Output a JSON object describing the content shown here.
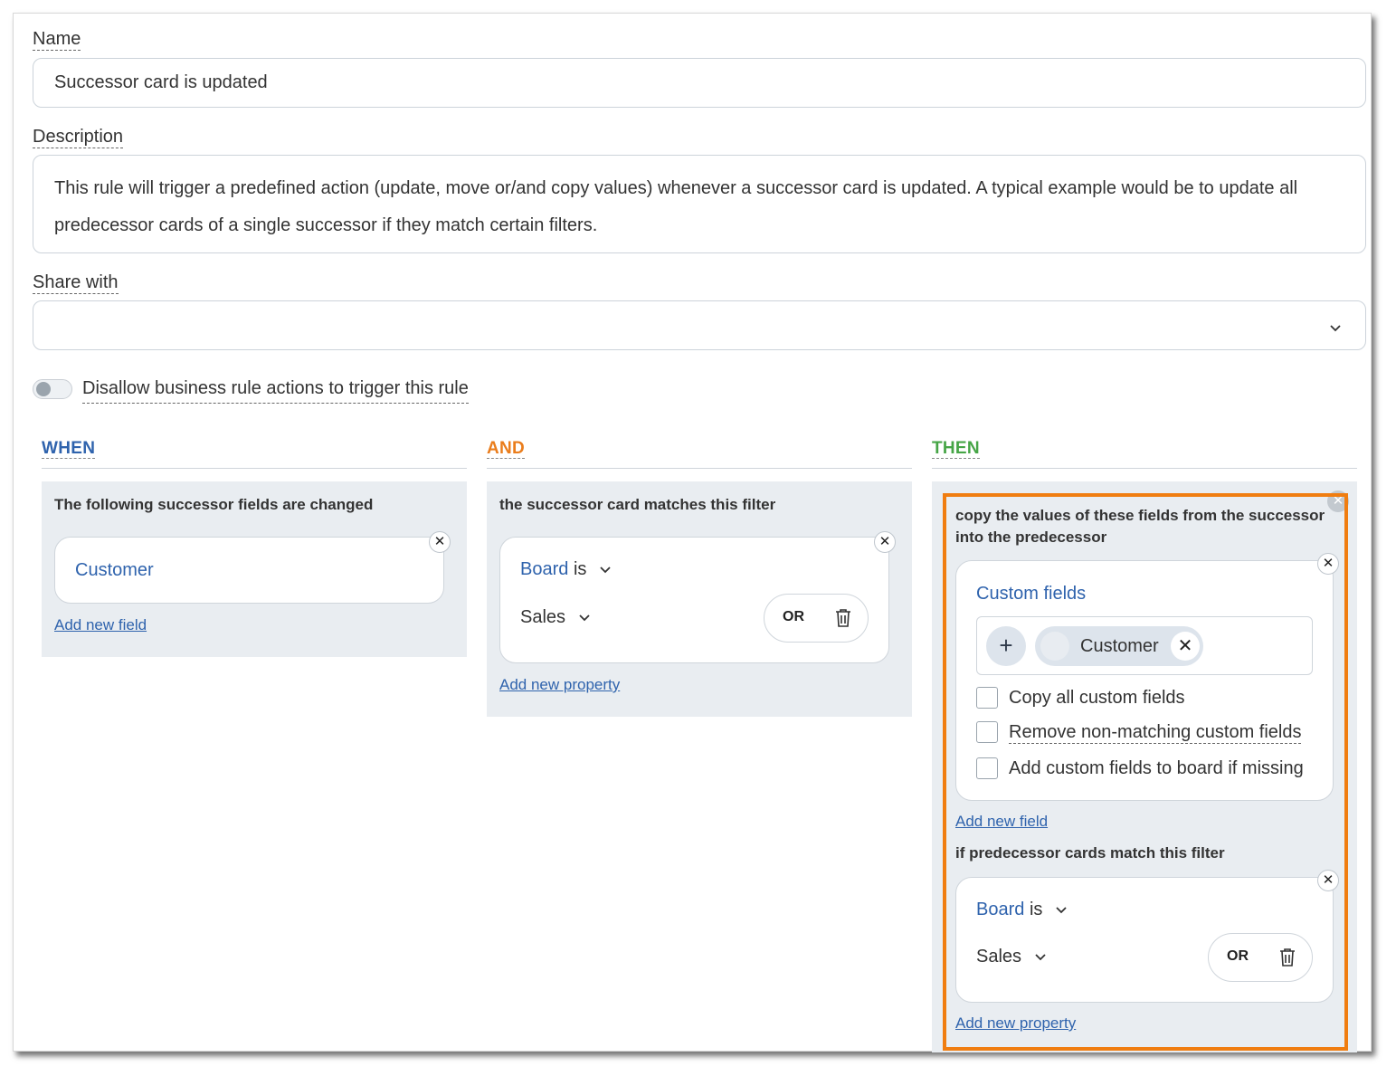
{
  "form": {
    "name_label": "Name",
    "name_value": "Successor card is updated",
    "description_label": "Description",
    "description_value": "This rule will trigger a predefined action (update, move or/and copy values) whenever a successor card is updated. A typical example would be to update all predecessor cards of a single successor if they match certain filters.",
    "share_label": "Share with",
    "share_value": "",
    "toggle_label": "Disallow business rule actions to trigger this rule",
    "toggle_on": false
  },
  "columns": {
    "when": {
      "heading": "WHEN",
      "color": "#2f63ad",
      "title": "The following successor fields are changed",
      "field": "Customer",
      "add_link": "Add new field"
    },
    "and": {
      "heading": "AND",
      "color": "#ea7d1c",
      "title": "the successor card matches this filter",
      "property": "Board",
      "operator": "is",
      "value": "Sales",
      "or_label": "OR",
      "add_link": "Add new property"
    },
    "then": {
      "heading": "THEN",
      "color": "#46a546",
      "title": "copy the values of these fields from the successor into the predecessor",
      "custom_fields_label": "Custom fields",
      "chip": "Customer",
      "checkboxes": [
        {
          "label": "Copy all custom fields",
          "checked": false
        },
        {
          "label": "Remove non-matching custom fields",
          "checked": false
        },
        {
          "label": "Add custom fields to board if missing",
          "checked": false
        }
      ],
      "add_field_link": "Add new field",
      "filter_title": "if predecessor cards match this filter",
      "property": "Board",
      "operator": "is",
      "value": "Sales",
      "or_label": "OR",
      "add_property_link": "Add new property"
    }
  },
  "highlight_color": "#f07d10",
  "icons": [
    "chevron-down-icon",
    "close-icon",
    "trash-icon",
    "plus-icon"
  ]
}
